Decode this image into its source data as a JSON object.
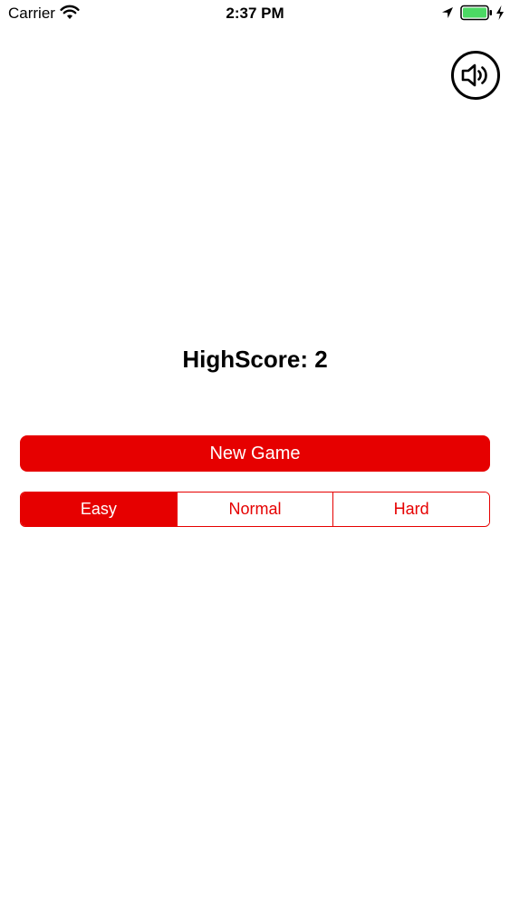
{
  "status_bar": {
    "carrier": "Carrier",
    "time": "2:37 PM",
    "battery_level": 1.0
  },
  "sound_button": {
    "icon": "speaker-icon"
  },
  "highscore": {
    "text": "HighScore: 2"
  },
  "new_game": {
    "label": "New Game"
  },
  "difficulty": {
    "options": [
      "Easy",
      "Normal",
      "Hard"
    ],
    "selected": "Easy"
  },
  "colors": {
    "accent": "#e60000",
    "battery": "#4cd964",
    "text": "#000000",
    "background": "#ffffff"
  }
}
